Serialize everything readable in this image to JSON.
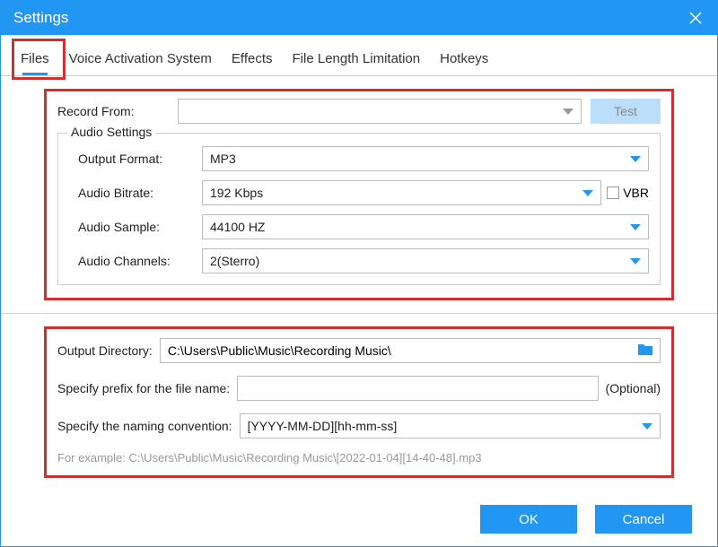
{
  "window": {
    "title": "Settings"
  },
  "tabs": {
    "files": "Files",
    "voice": "Voice Activation System",
    "effects": "Effects",
    "limitation": "File Length Limitation",
    "hotkeys": "Hotkeys"
  },
  "record": {
    "label": "Record  From:",
    "value": "",
    "test_label": "Test"
  },
  "audio": {
    "legend": "Audio Settings",
    "format_label": "Output Format:",
    "format_value": "MP3",
    "bitrate_label": "Audio Bitrate:",
    "bitrate_value": "192 Kbps",
    "vbr_label": "VBR",
    "sample_label": "Audio Sample:",
    "sample_value": "44100 HZ",
    "channels_label": "Audio Channels:",
    "channels_value": "2(Sterro)"
  },
  "output": {
    "dir_label": "Output Directory:",
    "dir_value": "C:\\Users\\Public\\Music\\Recording Music\\",
    "prefix_label": "Specify prefix for the file name:",
    "prefix_value": "",
    "optional": "(Optional)",
    "naming_label": "Specify the naming convention:",
    "naming_value": "[YYYY-MM-DD][hh-mm-ss]",
    "example": "For example: C:\\Users\\Public\\Music\\Recording Music\\[2022-01-04][14-40-48].mp3"
  },
  "footer": {
    "ok": "OK",
    "cancel": "Cancel"
  }
}
